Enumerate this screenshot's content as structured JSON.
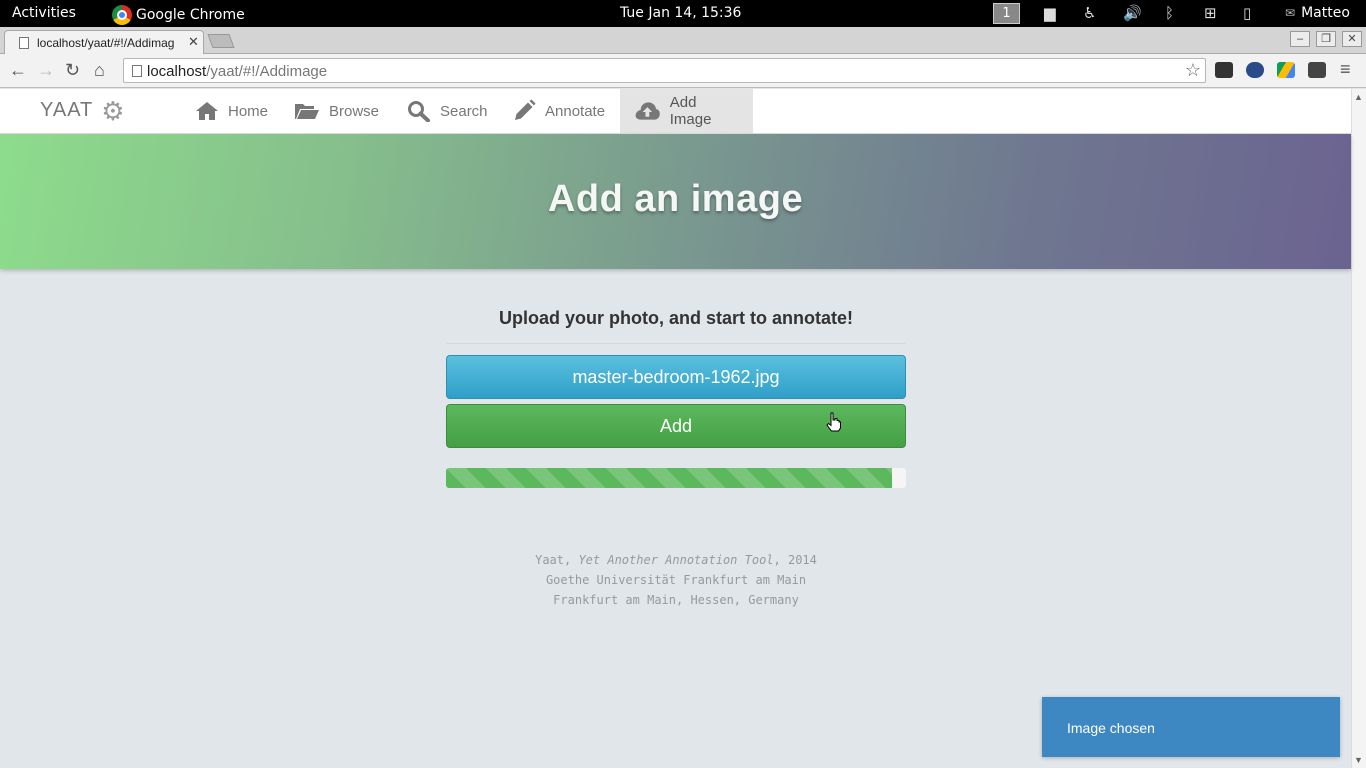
{
  "system": {
    "activities": "Activities",
    "app_name": "Google Chrome",
    "clock": "Tue Jan 14, 15:36",
    "workspace": "1",
    "user": "Matteo"
  },
  "browser": {
    "tab_title": "localhost/yaat/#!/Addimag",
    "url_host": "localhost",
    "url_path": "/yaat/#!/Addimage"
  },
  "navbar": {
    "brand": "YAAT",
    "items": [
      {
        "label": "Home",
        "icon": "home-icon"
      },
      {
        "label": "Browse",
        "icon": "folder-open-icon"
      },
      {
        "label": "Search",
        "icon": "search-icon"
      },
      {
        "label": "Annotate",
        "icon": "pencil-icon"
      },
      {
        "label": "Add Image",
        "icon": "cloud-upload-icon",
        "active": true
      }
    ]
  },
  "hero": {
    "title": "Add an image"
  },
  "upload": {
    "subtitle": "Upload your photo, and start to annotate!",
    "file_label": "master-bedroom-1962.jpg",
    "add_label": "Add",
    "progress_fraction": 0.97
  },
  "footer": {
    "name": "Yaat, ",
    "full_name": "Yet Another Annotation Tool",
    "year": ", 2014",
    "line2": "Goethe Universität Frankfurt am Main",
    "line3": "Frankfurt am Main, Hessen, Germany"
  },
  "toast": {
    "message": "Image chosen"
  },
  "colors": {
    "file_button": "#3aa8d2",
    "add_button": "#52ad52",
    "toast": "#3d87c3",
    "hero_start": "#8ddc8c",
    "hero_end": "#6b6391"
  }
}
